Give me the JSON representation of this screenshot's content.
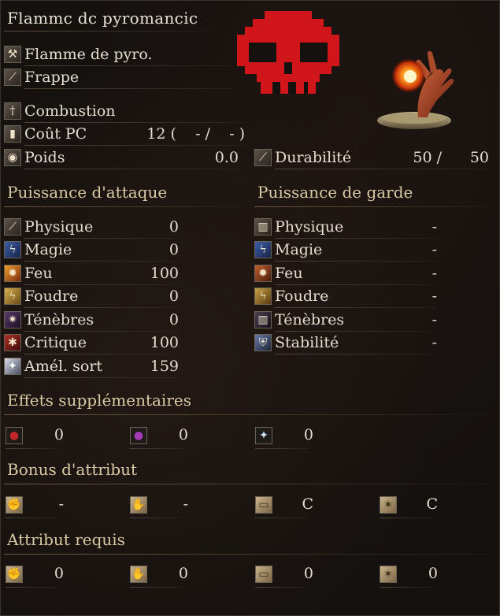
{
  "item": {
    "name": "Flammc dc pyromancic"
  },
  "info": {
    "weapon_type": "Flamme de pyro.",
    "attack_type": "Frappe",
    "skill": "Combustion",
    "fp_cost_label": "Coût PC",
    "fp_cost_value": "12 (    - /    - )",
    "weight_label": "Poids",
    "weight_value": "0.0",
    "durability_label": "Durabilité",
    "durability_current": "50 /",
    "durability_max": "50"
  },
  "attack_power": {
    "title": "Puissance d'attaque",
    "rows": [
      {
        "label": "Physique",
        "value": "0",
        "icon": "slash-icon"
      },
      {
        "label": "Magie",
        "value": "0",
        "icon": "magic-icon"
      },
      {
        "label": "Feu",
        "value": "100",
        "icon": "fire-icon"
      },
      {
        "label": "Foudre",
        "value": "0",
        "icon": "lightning-icon"
      },
      {
        "label": "Ténèbres",
        "value": "0",
        "icon": "dark-icon"
      },
      {
        "label": "Critique",
        "value": "100",
        "icon": "critical-icon"
      },
      {
        "label": "Amél. sort",
        "value": "159",
        "icon": "spell-buff-icon"
      }
    ]
  },
  "guard": {
    "title": "Puissance de garde",
    "rows": [
      {
        "label": "Physique",
        "value": "-",
        "icon": "physical-guard-icon"
      },
      {
        "label": "Magie",
        "value": "-",
        "icon": "magic-guard-icon"
      },
      {
        "label": "Feu",
        "value": "-",
        "icon": "fire-guard-icon"
      },
      {
        "label": "Foudre",
        "value": "-",
        "icon": "lightning-guard-icon"
      },
      {
        "label": "Ténèbres",
        "value": "-",
        "icon": "dark-guard-icon"
      },
      {
        "label": "Stabilité",
        "value": "-",
        "icon": "stability-icon"
      }
    ]
  },
  "effects": {
    "title": "Effets supplémentaires",
    "items": [
      {
        "icon": "bleed-icon",
        "value": "0"
      },
      {
        "icon": "poison-icon",
        "value": "0"
      },
      {
        "icon": "frost-icon",
        "value": "0"
      }
    ]
  },
  "scaling": {
    "title": "Bonus d'attribut",
    "items": [
      {
        "icon": "strength-icon",
        "value": "-"
      },
      {
        "icon": "dexterity-icon",
        "value": "-"
      },
      {
        "icon": "intelligence-icon",
        "value": "C"
      },
      {
        "icon": "faith-icon",
        "value": "C"
      }
    ]
  },
  "requirements": {
    "title": "Attribut requis",
    "items": [
      {
        "icon": "strength-icon",
        "value": "0"
      },
      {
        "icon": "dexterity-icon",
        "value": "0"
      },
      {
        "icon": "intelligence-icon",
        "value": "0"
      },
      {
        "icon": "faith-icon",
        "value": "0"
      }
    ]
  },
  "colors": {
    "section_title": "#d9c9a3",
    "text": "#e4ddd0",
    "skull": "#d0161b"
  }
}
